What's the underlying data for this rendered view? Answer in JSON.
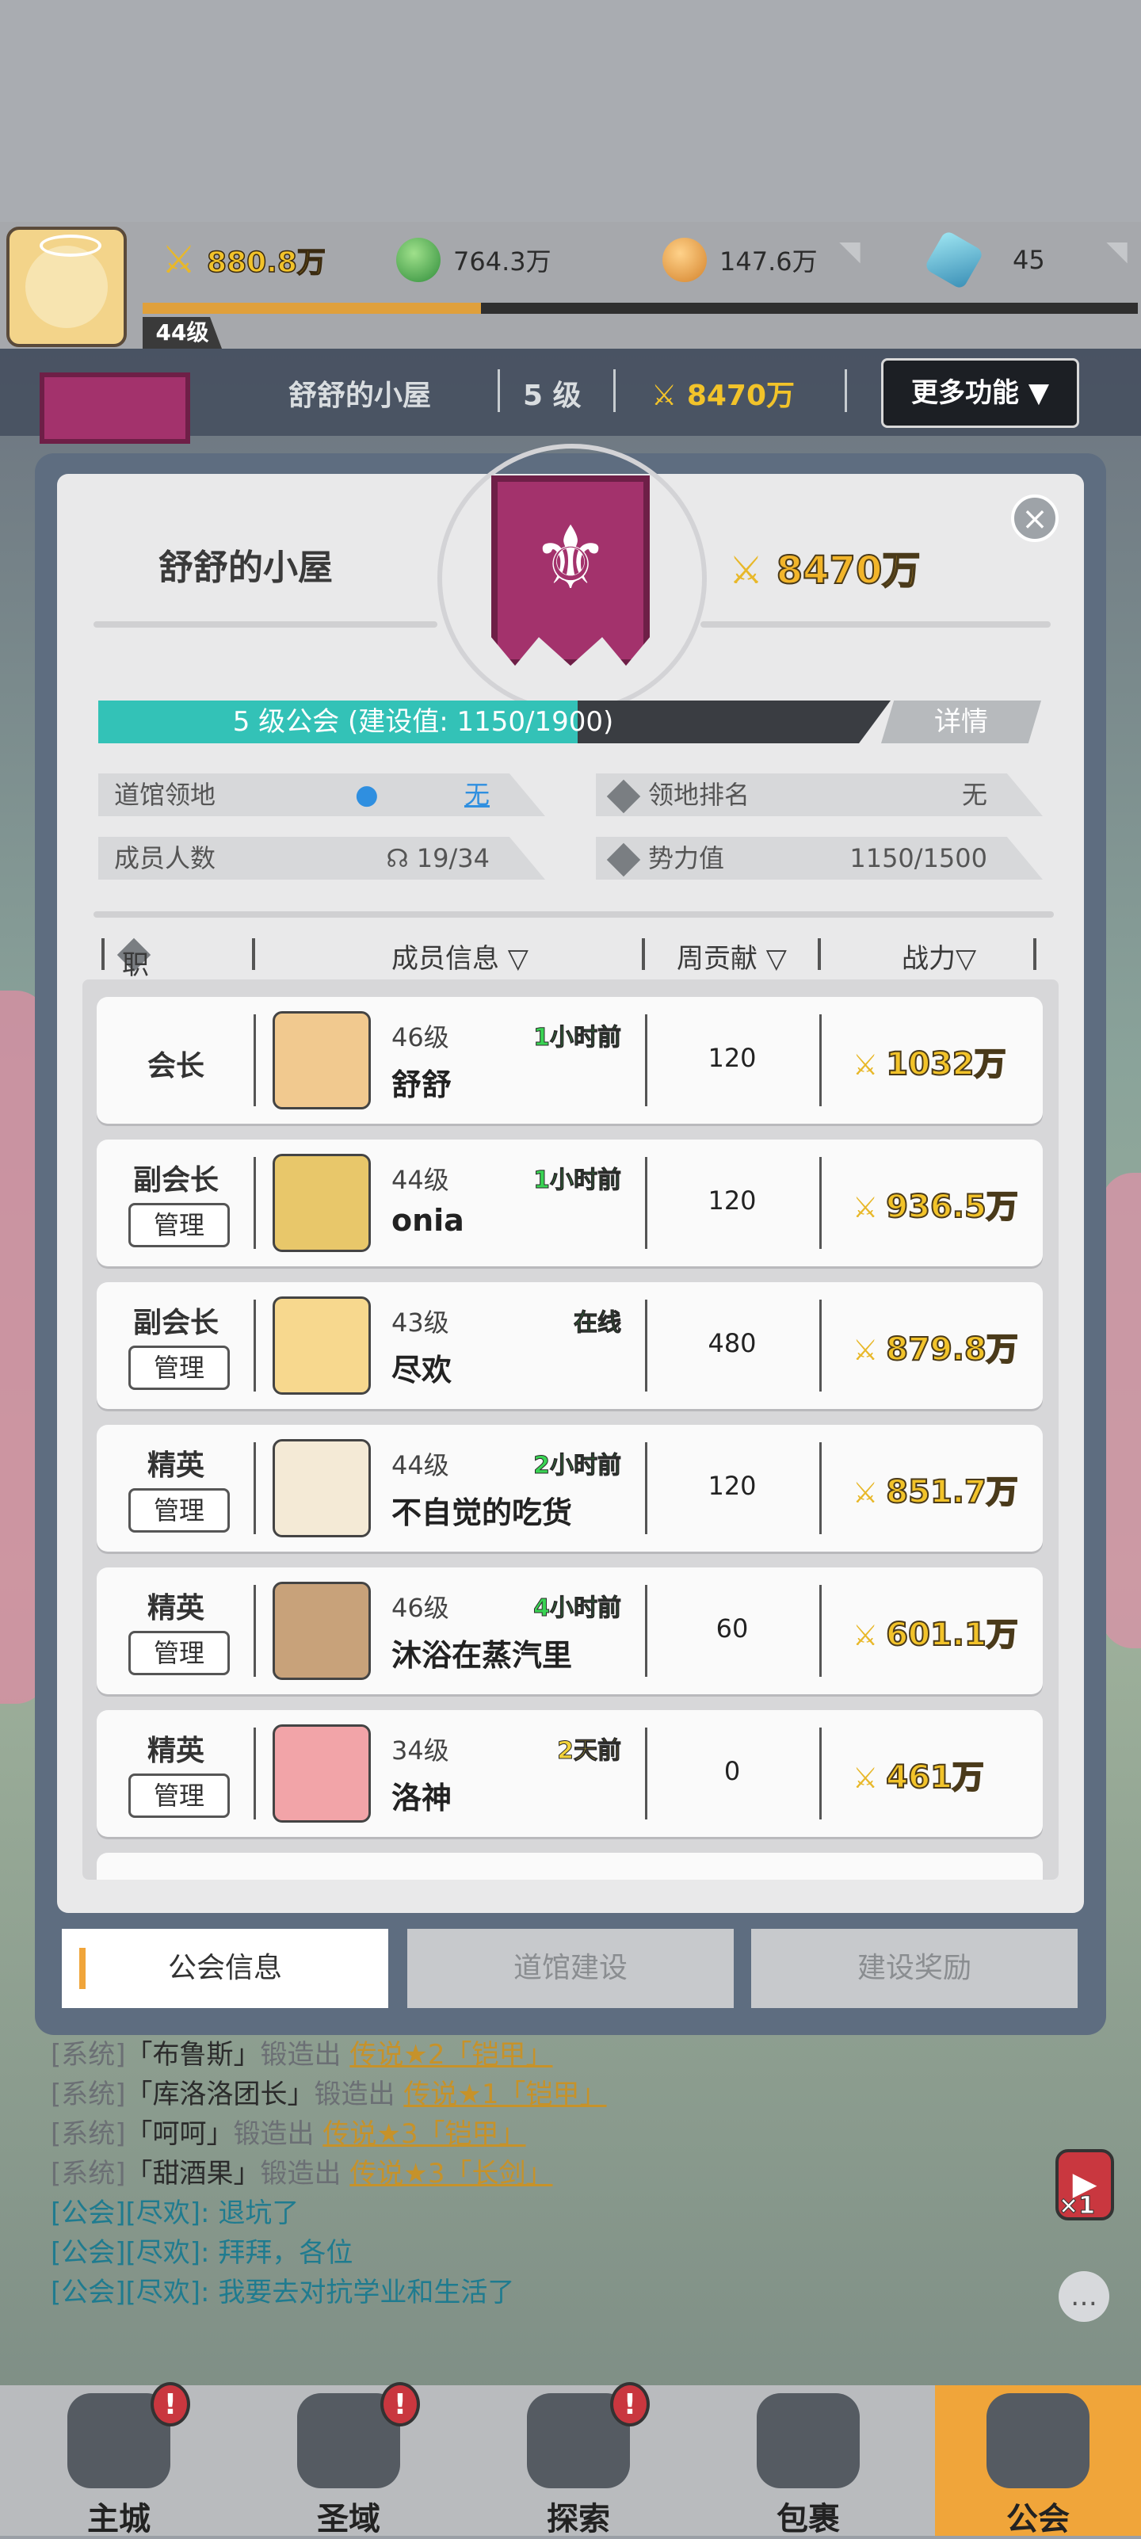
{
  "top": {
    "player_level": "44级",
    "resources": [
      {
        "icon": "sword-power-icon",
        "value": "880.8万"
      },
      {
        "icon": "green-orb-icon",
        "value": "764.3万"
      },
      {
        "icon": "gold-coin-icon",
        "value": "147.6万"
      },
      {
        "icon": "blue-gem-icon",
        "value": "45"
      }
    ],
    "exp_fraction": 0.34
  },
  "guild_header": {
    "name": "舒舒的小屋",
    "level": "5 级",
    "power": "8470万",
    "more_button": "更多功能 ▼"
  },
  "panel": {
    "guild_name": "舒舒的小屋",
    "guild_power": "8470万",
    "level_text": "5 级公会 (建设值:  1150/1900)",
    "level_progress": 0.605,
    "detail_button": "详情",
    "info": {
      "territory_label": "道馆领地",
      "territory_value": "无",
      "rank_label": "领地排名",
      "rank_value": "无",
      "members_label": "成员人数",
      "members_value": "19/34",
      "influence_label": "势力值",
      "influence_value": "1150/1500"
    },
    "table_headers": {
      "position": "职位",
      "member": "成员信息 ▽",
      "weekly": "周贡献 ▽",
      "power": "战力▽"
    },
    "manage_label": "管理",
    "members": [
      {
        "role": "会长",
        "level": "46级",
        "name": "舒舒",
        "status": "1小时前",
        "contrib": "120",
        "power": "1032万",
        "manage": false
      },
      {
        "role": "副会长",
        "level": "44级",
        "name": "onia",
        "status": "1小时前",
        "contrib": "120",
        "power": "936.5万",
        "manage": true
      },
      {
        "role": "副会长",
        "level": "43级",
        "name": "尽欢",
        "status": "在线",
        "contrib": "480",
        "power": "879.8万",
        "manage": true
      },
      {
        "role": "精英",
        "level": "44级",
        "name": "不自觉的吃货",
        "status": "2小时前",
        "contrib": "120",
        "power": "851.7万",
        "manage": true
      },
      {
        "role": "精英",
        "level": "46级",
        "name": "沐浴在蒸汽里",
        "status": "4小时前",
        "contrib": "60",
        "power": "601.1万",
        "manage": true
      },
      {
        "role": "精英",
        "level": "34级",
        "name": "洛神",
        "status": "2天前",
        "contrib": "0",
        "power": "461万",
        "manage": true
      }
    ]
  },
  "tabs": [
    "公会信息",
    "道馆建设",
    "建设奖励"
  ],
  "chat": [
    {
      "prefix": "[系统]",
      "player": "「布鲁斯」",
      "action": "锻造出",
      "item": "传说★2「铠甲」"
    },
    {
      "prefix": "[系统]",
      "player": "「库洛洛团长」",
      "action": "锻造出",
      "item": "传说★1「铠甲」"
    },
    {
      "prefix": "[系统]",
      "player": "「呵呵」",
      "action": "锻造出",
      "item": "传说★3「铠甲」"
    },
    {
      "prefix": "[系统]",
      "player": "「甜酒果」",
      "action": "锻造出",
      "item": "传说★3「长剑」"
    },
    {
      "prefix": "[公会][尽欢]:",
      "msg": "退坑了"
    },
    {
      "prefix": "[公会][尽欢]:",
      "msg": "拜拜，各位"
    },
    {
      "prefix": "[公会][尽欢]:",
      "msg": "我要去对抗学业和生活了"
    }
  ],
  "side": {
    "video_multiplier": "×1"
  },
  "nav": [
    {
      "label": "主城",
      "badge": "!"
    },
    {
      "label": "圣域",
      "badge": "!"
    },
    {
      "label": "探索",
      "badge": "!"
    },
    {
      "label": "包裹",
      "badge": ""
    },
    {
      "label": "公会",
      "badge": ""
    }
  ],
  "colors": {
    "accent_teal": "#33c2b7",
    "power_gold": "#f2c32a",
    "online_green": "#39d353",
    "nav_active": "#f0a53a"
  }
}
